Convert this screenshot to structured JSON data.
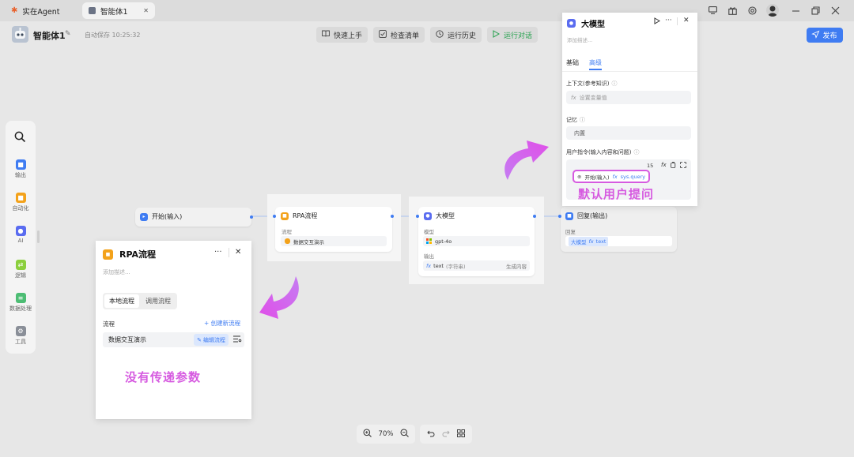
{
  "tabs": [
    {
      "label": "实在Agent",
      "icon": "pinwheel-icon"
    },
    {
      "label": "智能体1",
      "icon": "agent-icon",
      "close": "✕"
    }
  ],
  "window_controls": [
    "screen-icon",
    "gift-icon",
    "settings-icon",
    "avatar",
    "minimize-icon",
    "restore-icon",
    "close-icon"
  ],
  "header": {
    "agent_name": "智能体1",
    "autosave": "自动保存 10:25:32",
    "quick_start": "快速上手",
    "checklist": "检查清单",
    "run_history": "运行历史",
    "run_dialog": "运行对话",
    "publish": "发布"
  },
  "rail": {
    "items": [
      {
        "label": "输出",
        "icon": "output-icon",
        "color": "#3f7cf2"
      },
      {
        "label": "自动化",
        "icon": "automation-icon",
        "color": "#f3a21b"
      },
      {
        "label": "AI",
        "icon": "ai-icon",
        "color": "#5a6cf0"
      },
      {
        "label": "逻辑",
        "icon": "logic-icon",
        "color": "#8bcf3d"
      },
      {
        "label": "数据处理",
        "icon": "data-icon",
        "color": "#4dbd74"
      },
      {
        "label": "工具",
        "icon": "tool-icon",
        "color": "#8a8f98"
      }
    ]
  },
  "nodes": {
    "start": {
      "title": "开始(输入)"
    },
    "rpa": {
      "title": "RPA流程",
      "field_label": "流程",
      "field_value": "数据交互演示"
    },
    "llm": {
      "title": "大模型",
      "model_label": "模型",
      "model_value": "gpt-4o",
      "output_label": "输出",
      "output_value": "text",
      "output_type": "(字符串)",
      "output_desc": "生成内容"
    },
    "reply": {
      "title": "回复(输出)",
      "reply_label": "回复",
      "chip_source": "大模型",
      "chip_var": "text"
    }
  },
  "rpa_panel": {
    "title": "RPA流程",
    "description_placeholder": "添加描述...",
    "tab_local": "本地流程",
    "tab_call": "调用流程",
    "flow_label": "流程",
    "create_link": "+ 创建新流程",
    "flow_value": "数据交互演示",
    "edit_link": "编辑流程",
    "annotation": "没有传递参数"
  },
  "llm_panel": {
    "title": "大模型",
    "description_placeholder": "添加描述...",
    "tab_basic": "基础",
    "tab_advanced": "高级",
    "context_label": "上下文(参考知识)",
    "context_placeholder": "设置变量值",
    "memory_label": "记忆",
    "memory_value": "内置",
    "instruction_label": "用户指令(输入内容和问题)",
    "char_count": "15",
    "chip_start": "开始(输入)",
    "chip_var": "sys.query",
    "annotation": "默认用户提问"
  },
  "zoom": {
    "level": "70%"
  },
  "colors": {
    "accent": "#3f7cf2",
    "annotation": "#d65ae0",
    "run_green": "#22a04b"
  }
}
